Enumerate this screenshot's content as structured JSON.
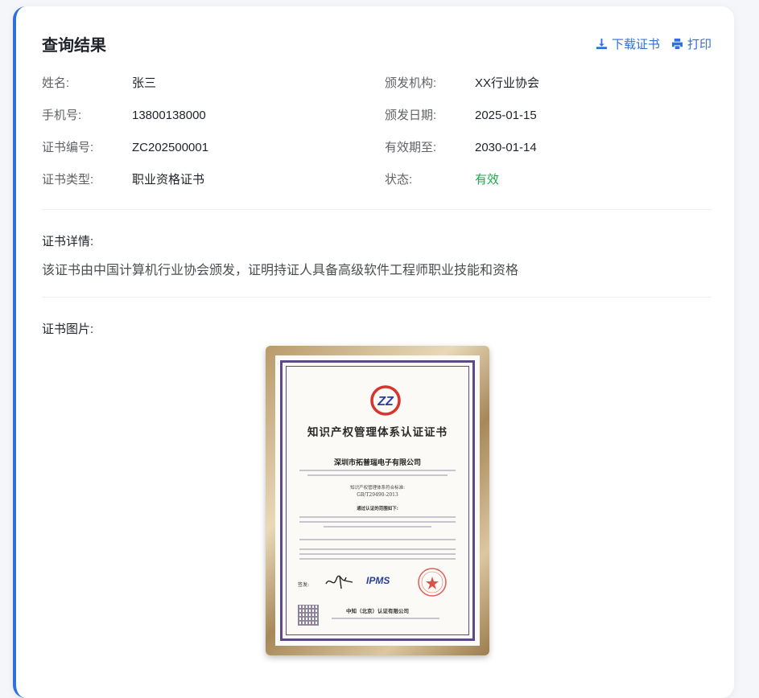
{
  "header": {
    "title": "查询结果",
    "download_label": "下载证书",
    "print_label": "打印"
  },
  "info": {
    "name_label": "姓名:",
    "name_value": "张三",
    "issuer_label": "颁发机构:",
    "issuer_value": "XX行业协会",
    "phone_label": "手机号:",
    "phone_value": "13800138000",
    "issue_date_label": "颁发日期:",
    "issue_date_value": "2025-01-15",
    "cert_no_label": "证书编号:",
    "cert_no_value": "ZC202500001",
    "expiry_label": "有效期至:",
    "expiry_value": "2030-01-14",
    "type_label": "证书类型:",
    "type_value": "职业资格证书",
    "status_label": "状态:",
    "status_value": "有效"
  },
  "details": {
    "label": "证书详情:",
    "text": "该证书由中国计算机行业协会颁发，证明持证人具备高级软件工程师职业技能和资格"
  },
  "image_section": {
    "label": "证书图片:"
  },
  "certificate": {
    "title": "知识产权管理体系认证证书",
    "company": "深圳市拓普瑞电子有限公司",
    "standard_label": "知识产权管理体系符合标准:",
    "standard": "GB/T29490-2013",
    "scope_label": "通过认证的范围如下:",
    "signature_label": "签发:",
    "issuer": "中知（北京）认证有限公司",
    "logo_text": "IPMS"
  },
  "colors": {
    "accent": "#2f6fde",
    "valid": "#1ea84a",
    "frame": "#5b4a86"
  }
}
